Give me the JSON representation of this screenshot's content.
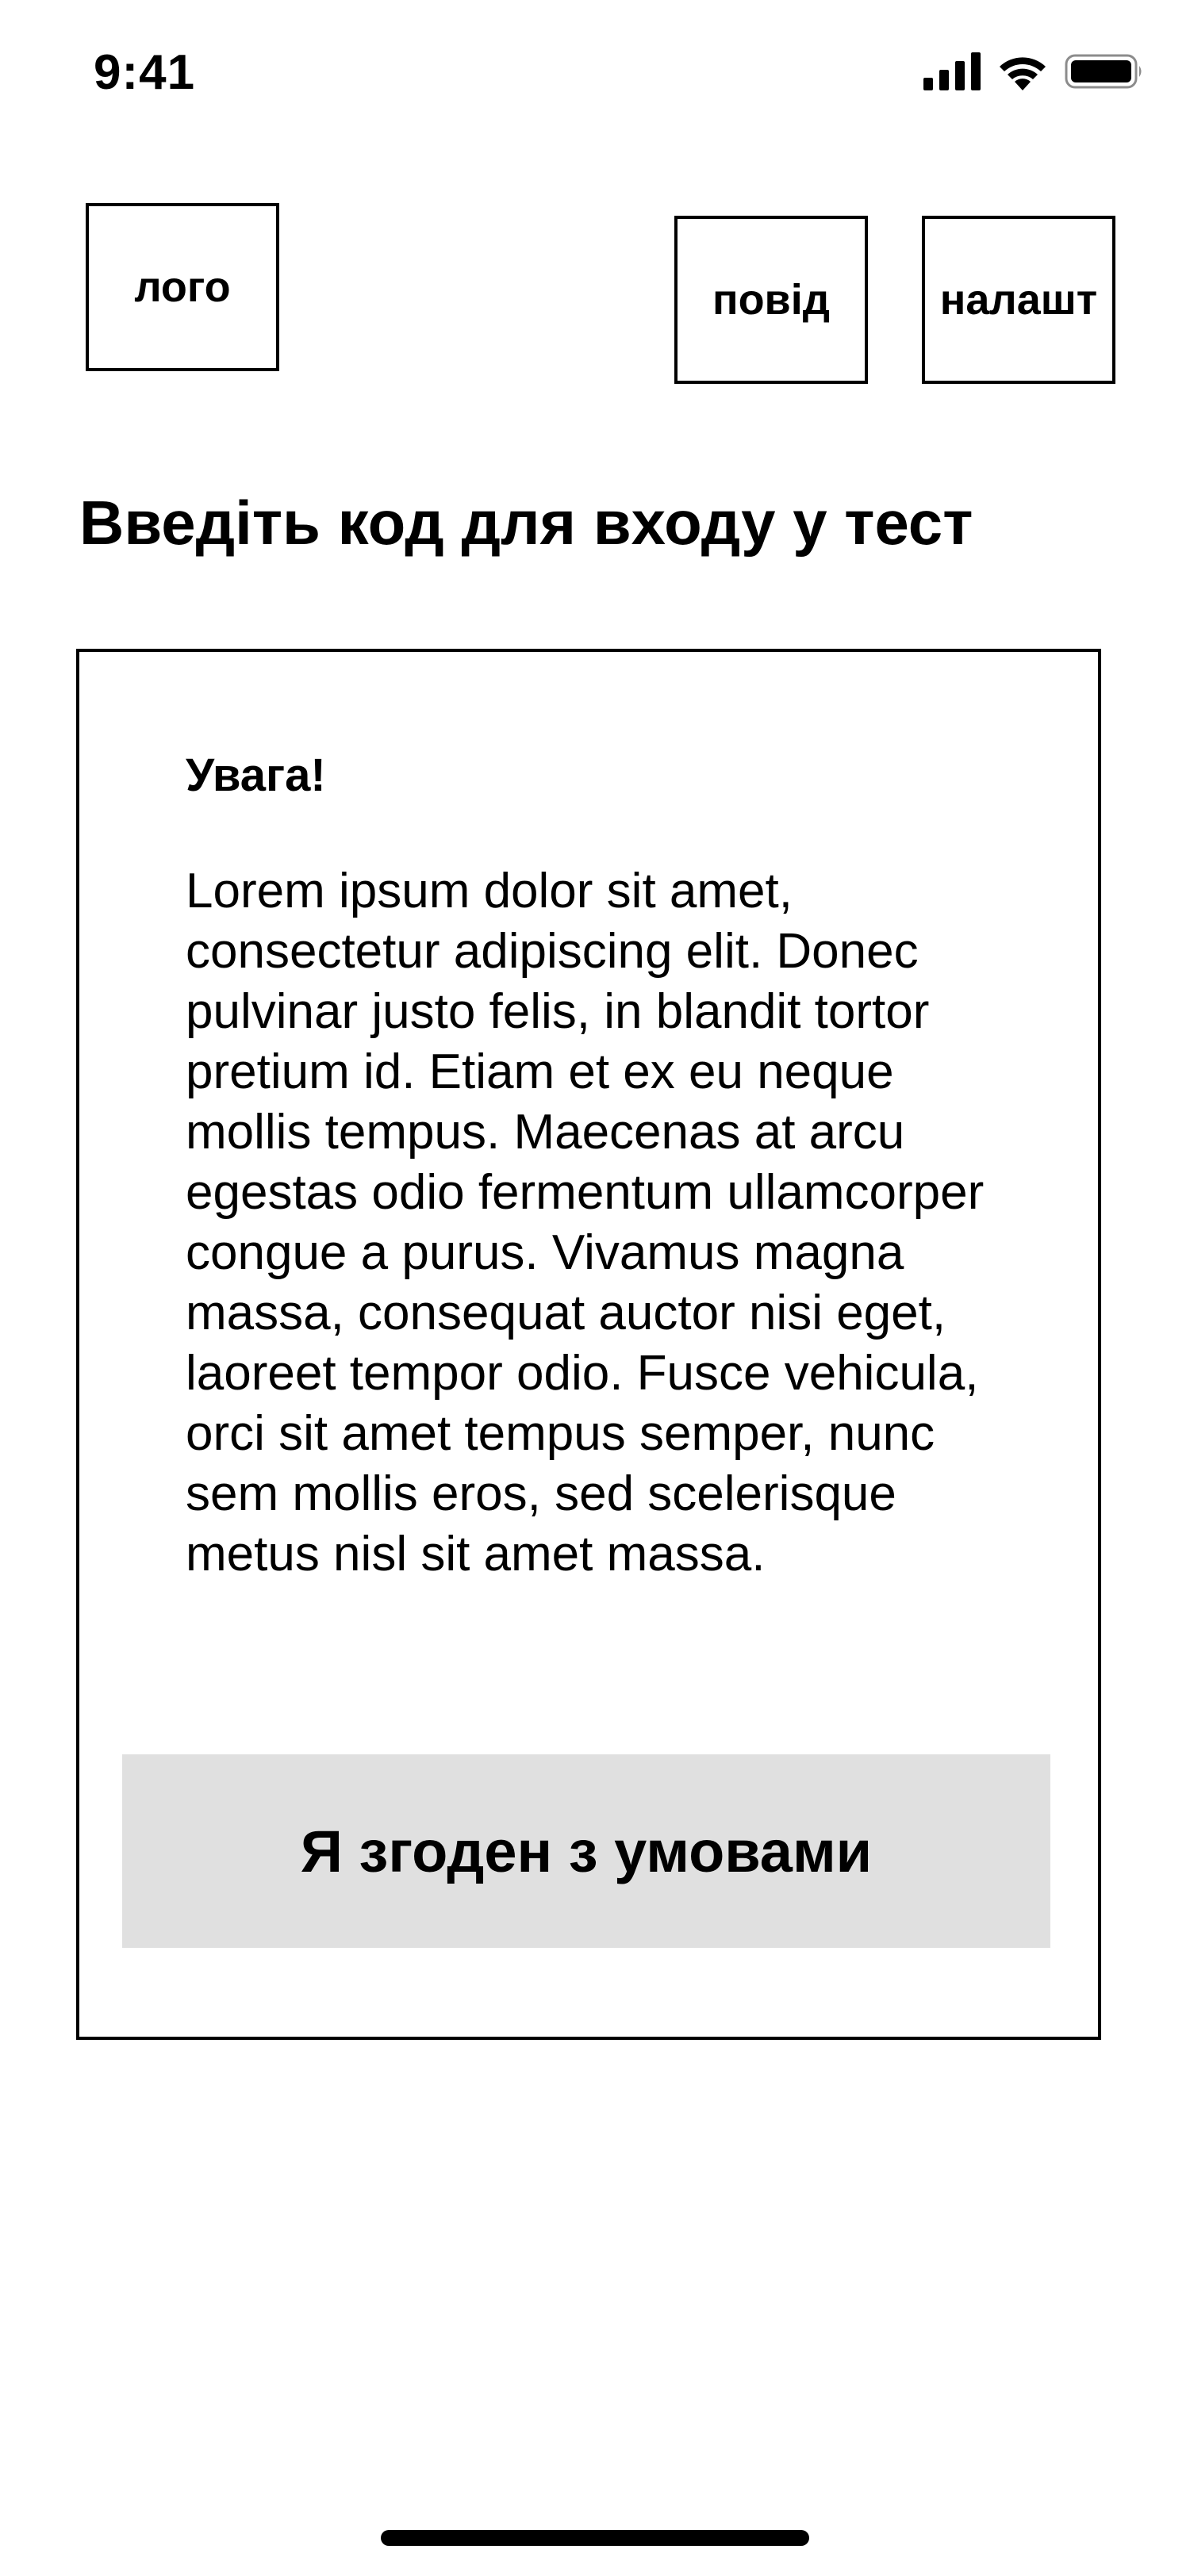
{
  "status_bar": {
    "time": "9:41",
    "icons": [
      "cellular-signal-icon",
      "wifi-icon",
      "battery-icon"
    ]
  },
  "header": {
    "logo_label": "лого",
    "history_label": "повід",
    "settings_label": "налашт"
  },
  "page": {
    "title": "Введіть код для входу у тест"
  },
  "card": {
    "heading": "Увага!",
    "body": "Lorem ipsum dolor sit amet, consectetur adipiscing elit. Donec pulvinar justo felis, in blandit tortor pretium id. Etiam et ex eu neque mollis tempus. Maecenas at arcu egestas odio fermentum ullamcorper congue a purus. Vivamus magna massa, consequat auctor nisi eget, laoreet tempor odio. Fusce vehicula, orci sit amet tempus semper, nunc sem mollis eros, sed scelerisque metus nisl sit amet massa.",
    "agree_button_label": "Я згоден з умовами"
  },
  "colors": {
    "text": "#000000",
    "background": "#ffffff",
    "button_background": "#e0e0e0"
  }
}
